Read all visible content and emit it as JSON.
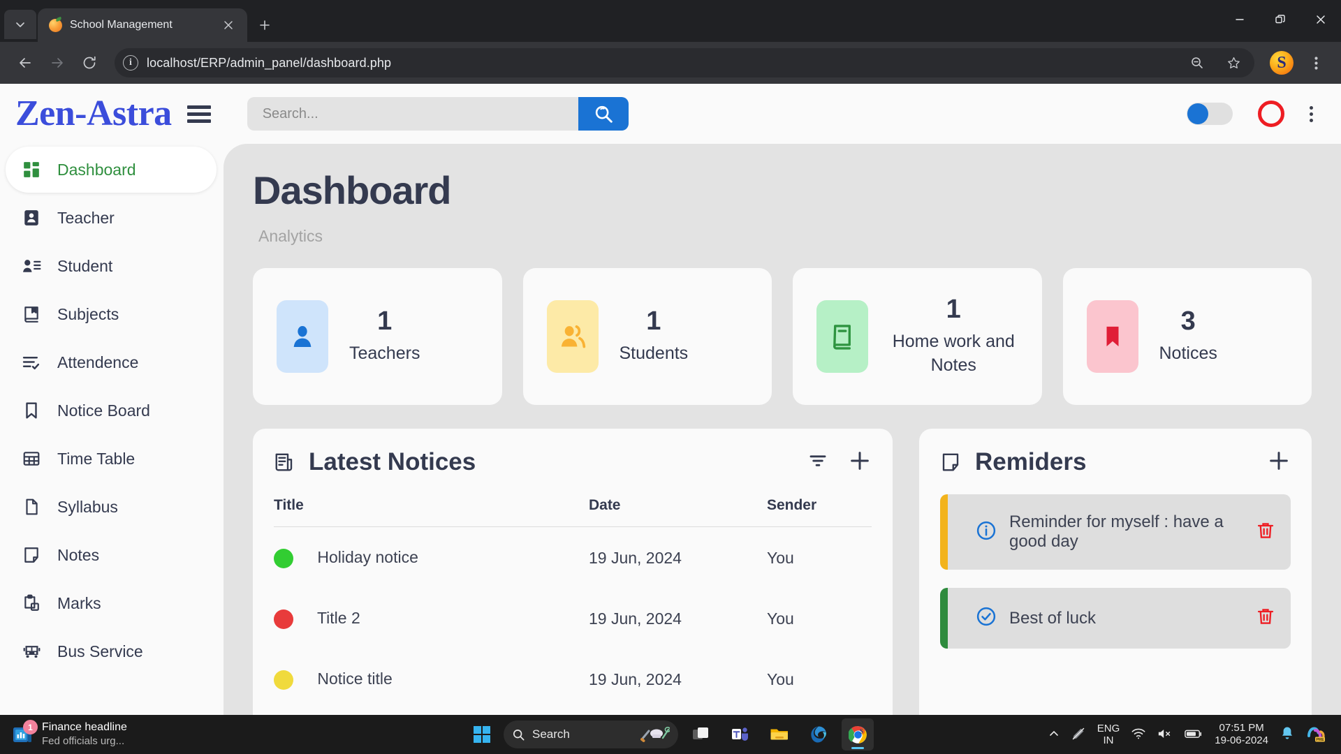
{
  "browser": {
    "tab": {
      "title": "School Management",
      "favicon": "mango-icon"
    },
    "url": "localhost/ERP/admin_panel/dashboard.php",
    "profile_initial": "S",
    "window": {
      "minimize": "–",
      "restore": "❐",
      "close": "✕"
    }
  },
  "app": {
    "logo": "Zen-Astra",
    "search": {
      "placeholder": "Search...",
      "value": ""
    }
  },
  "sidebar": {
    "items": [
      {
        "label": "Dashboard",
        "icon": "grid-icon",
        "active": true
      },
      {
        "label": "Teacher",
        "icon": "person-badge-icon",
        "active": false
      },
      {
        "label": "Student",
        "icon": "person-list-icon",
        "active": false
      },
      {
        "label": "Subjects",
        "icon": "book-icon",
        "active": false
      },
      {
        "label": "Attendence",
        "icon": "list-check-icon",
        "active": false
      },
      {
        "label": "Notice Board",
        "icon": "bookmark-icon",
        "active": false
      },
      {
        "label": "Time Table",
        "icon": "table-icon",
        "active": false
      },
      {
        "label": "Syllabus",
        "icon": "file-icon",
        "active": false
      },
      {
        "label": "Notes",
        "icon": "note-icon",
        "active": false
      },
      {
        "label": "Marks",
        "icon": "clipboard-icon",
        "active": false
      },
      {
        "label": "Bus Service",
        "icon": "bus-icon",
        "active": false
      }
    ]
  },
  "main": {
    "title": "Dashboard",
    "subtitle": "Analytics",
    "stats": [
      {
        "value": "1",
        "label": "Teachers",
        "icon": "person-icon",
        "tile_color": "#cfe4fb",
        "icon_color": "#1a73d4"
      },
      {
        "value": "1",
        "label": "Students",
        "icon": "people-icon",
        "tile_color": "#fdeaa7",
        "icon_color": "#f9b233"
      },
      {
        "value": "1",
        "label": "Home work and Notes",
        "icon": "book-icon",
        "tile_color": "#b6f0c6",
        "icon_color": "#2e9440"
      },
      {
        "value": "3",
        "label": "Notices",
        "icon": "bookmark-icon",
        "tile_color": "#fbc5ce",
        "icon_color": "#e01e37"
      }
    ],
    "notices": {
      "title": "Latest Notices",
      "icon": "newspaper-icon",
      "filter_icon": "filter-icon",
      "add_icon": "plus-icon",
      "columns": [
        "Title",
        "Date",
        "Sender"
      ],
      "rows": [
        {
          "status_color": "#32cd32",
          "title": "Holiday notice",
          "date": "19 Jun, 2024",
          "sender": "You"
        },
        {
          "status_color": "#e83b3b",
          "title": "Title 2",
          "date": "19 Jun, 2024",
          "sender": "You"
        },
        {
          "status_color": "#f0da3c",
          "title": "Notice title",
          "date": "19 Jun, 2024",
          "sender": "You"
        }
      ]
    },
    "reminders": {
      "title": "Remiders",
      "icon": "note-icon",
      "add_icon": "plus-icon",
      "items": [
        {
          "text": "Reminder for myself : have a good day",
          "bar_color": "#f2b31c",
          "status_icon": "info-icon"
        },
        {
          "text": "Best of luck",
          "bar_color": "#2e8b3d",
          "status_icon": "check-circle-icon"
        }
      ]
    }
  },
  "taskbar": {
    "news": {
      "title": "Finance headline",
      "subtitle": "Fed officials urg...",
      "badge": "1"
    },
    "search_placeholder": "Search",
    "apps": [
      "task-view-icon",
      "teams-icon",
      "file-explorer-icon",
      "edge-icon",
      "chrome-icon"
    ],
    "tray": {
      "language": "ENG",
      "region": "IN",
      "time": "07:51 PM",
      "date": "19-06-2024"
    }
  }
}
